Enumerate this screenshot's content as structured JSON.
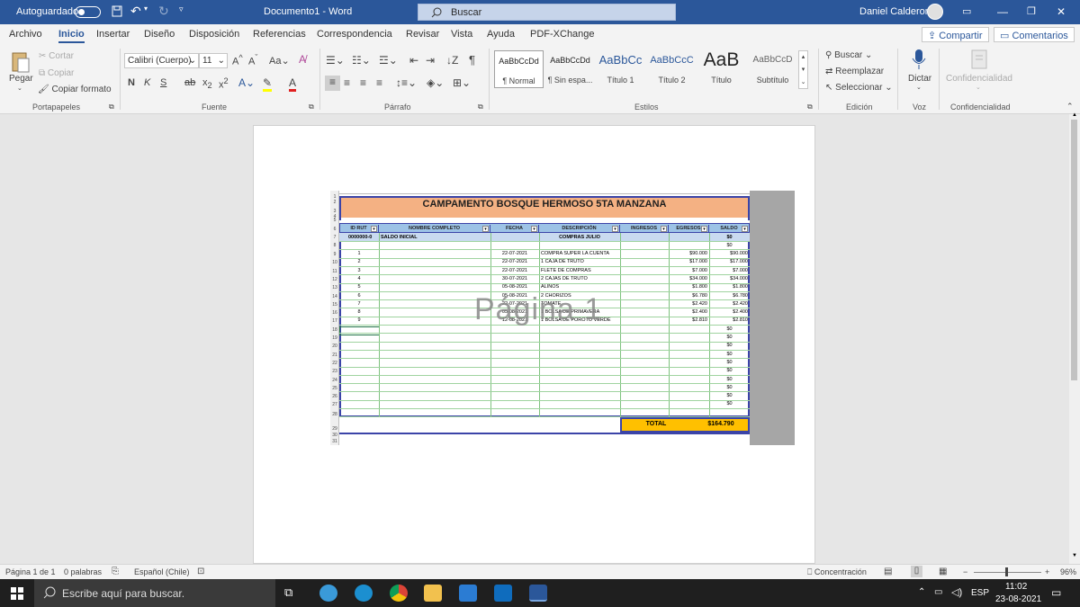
{
  "titlebar": {
    "autosave": "Autoguardado",
    "doc_title": "Documento1  -  Word",
    "search_placeholder": "Buscar",
    "user": "Daniel Calderon"
  },
  "menu": {
    "tabs": [
      "Archivo",
      "Inicio",
      "Insertar",
      "Diseño",
      "Disposición",
      "Referencias",
      "Correspondencia",
      "Revisar",
      "Vista",
      "Ayuda",
      "PDF-XChange"
    ],
    "active": "Inicio",
    "share": "Compartir",
    "comments": "Comentarios"
  },
  "ribbon": {
    "clipboard": {
      "paste": "Pegar",
      "cut": "Cortar",
      "copy": "Copiar",
      "format_painter": "Copiar formato",
      "label": "Portapapeles"
    },
    "font": {
      "name": "Calibri (Cuerpo)",
      "size": "11",
      "bold": "N",
      "italic": "K",
      "underline": "S",
      "label": "Fuente"
    },
    "paragraph": {
      "label": "Párrafo"
    },
    "styles": {
      "label": "Estilos",
      "items": [
        {
          "preview": "AaBbCcDd",
          "name": "¶ Normal"
        },
        {
          "preview": "AaBbCcDd",
          "name": "¶ Sin espa..."
        },
        {
          "preview": "AaBbCc",
          "name": "Título 1"
        },
        {
          "preview": "AaBbCcC",
          "name": "Título 2"
        },
        {
          "preview": "AaB",
          "name": "Título"
        },
        {
          "preview": "AaBbCcD",
          "name": "Subtítulo"
        }
      ]
    },
    "editing": {
      "find": "Buscar",
      "replace": "Reemplazar",
      "select": "Seleccionar",
      "label": "Edición"
    },
    "voice": {
      "dictate": "Dictar",
      "label": "Voz"
    },
    "sensitivity": {
      "button": "Confidencialidad",
      "label": "Confidencialidad"
    }
  },
  "sheet": {
    "title": "CAMPAMENTO BOSQUE HERMOSO 5TA MANZANA",
    "headers": [
      "ID RUT",
      "NOMBRE COMPLETO",
      "FECHA",
      "DESCRIPCIÓN",
      "INGRESOS",
      "EGRESOS",
      "SALDO"
    ],
    "saldo_row": {
      "id": "0000000-0",
      "name": "SALDO INICIAL",
      "desc": "COMPRAS JULIO",
      "saldo": "$0"
    },
    "rows": [
      {
        "id": "1",
        "fecha": "22-07-2021",
        "desc": "COMPRA SUPER LA CUENTA",
        "egreso": "$90.000",
        "saldo": "$90.000"
      },
      {
        "id": "2",
        "fecha": "22-07-2021",
        "desc": "1 CAJA DE TRUTO",
        "egreso": "$17.000",
        "saldo": "$17.000"
      },
      {
        "id": "3",
        "fecha": "22-07-2021",
        "desc": "FLETE DE COMPRAS",
        "egreso": "$7.000",
        "saldo": "$7.000"
      },
      {
        "id": "4",
        "fecha": "30-07-2021",
        "desc": "2 CAJAS DE TRUTO",
        "egreso": "$34.000",
        "saldo": "$34.000"
      },
      {
        "id": "5",
        "fecha": "05-08-2021",
        "desc": "ALIÑOS",
        "egreso": "$1.800",
        "saldo": "$1.800"
      },
      {
        "id": "6",
        "fecha": "05-08-2021",
        "desc": "2 CHORIZOS",
        "egreso": "$6.780",
        "saldo": "$6.780"
      },
      {
        "id": "7",
        "fecha": "22-07-2021",
        "desc": "TOMATE",
        "egreso": "$2.420",
        "saldo": "$2.420"
      },
      {
        "id": "8",
        "fecha": "05-08-2021",
        "desc": "1 BOLSA DE PRIMAVERA",
        "egreso": "$2.400",
        "saldo": "$2.400"
      },
      {
        "id": "9",
        "fecha": "12-08-2021",
        "desc": "1 BOLSA DE POROTO VERDE",
        "egreso": "$2.810",
        "saldo": "$2.810"
      }
    ],
    "empty_saldo": "$0",
    "total_label": "TOTAL",
    "total_value": "$164.790",
    "row_numbers": [
      "1",
      "2",
      "3",
      "4",
      "5",
      "6",
      "7",
      "8",
      "9",
      "10",
      "11",
      "12",
      "13",
      "14",
      "15",
      "16",
      "17",
      "18",
      "19",
      "20",
      "21",
      "22",
      "23",
      "24",
      "25",
      "26",
      "27",
      "28",
      "29",
      "30",
      "31"
    ],
    "watermark": "Página 1"
  },
  "status": {
    "page": "Página 1 de 1",
    "words": "0 palabras",
    "language": "Español (Chile)",
    "focus": "Concentración",
    "zoom": "96%"
  },
  "taskbar": {
    "search_placeholder": "Escribe aquí para buscar.",
    "lang": "ESP",
    "time": "11:02",
    "date": "23-08-2021"
  },
  "colors": {
    "word_blue": "#2b579a",
    "header_salmon": "#f4b183",
    "header_blue": "#9dc3e6",
    "total_yellow": "#ffc000",
    "grid_green": "#7fc27f"
  }
}
